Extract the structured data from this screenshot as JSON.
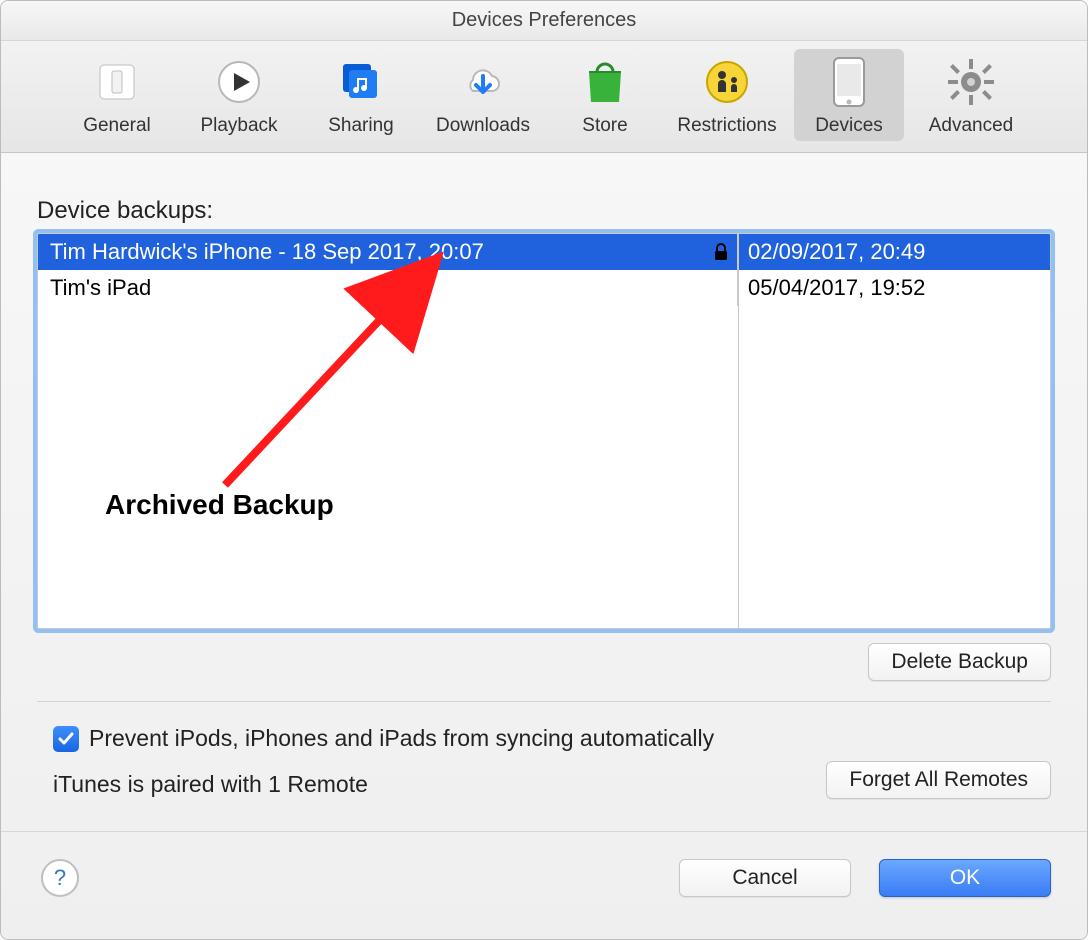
{
  "window": {
    "title": "Devices Preferences"
  },
  "toolbar": {
    "items": [
      {
        "label": "General"
      },
      {
        "label": "Playback"
      },
      {
        "label": "Sharing"
      },
      {
        "label": "Downloads"
      },
      {
        "label": "Store"
      },
      {
        "label": "Restrictions"
      },
      {
        "label": "Devices"
      },
      {
        "label": "Advanced"
      }
    ],
    "active_index": 6
  },
  "backups": {
    "section_label": "Device backups:",
    "rows": [
      {
        "name": "Tim Hardwick's iPhone - 18 Sep 2017, 20:07",
        "date": "02/09/2017, 20:49",
        "locked": true,
        "selected": true
      },
      {
        "name": "Tim's iPad",
        "date": "05/04/2017, 19:52",
        "locked": false,
        "selected": false
      }
    ],
    "delete_label": "Delete Backup"
  },
  "options": {
    "prevent_sync_label": "Prevent iPods, iPhones and iPads from syncing automatically",
    "prevent_sync_checked": true,
    "paired_text": "iTunes is paired with 1 Remote",
    "forget_label": "Forget All Remotes"
  },
  "footer": {
    "cancel_label": "Cancel",
    "ok_label": "OK"
  },
  "annotation": {
    "text": "Archived Backup"
  }
}
